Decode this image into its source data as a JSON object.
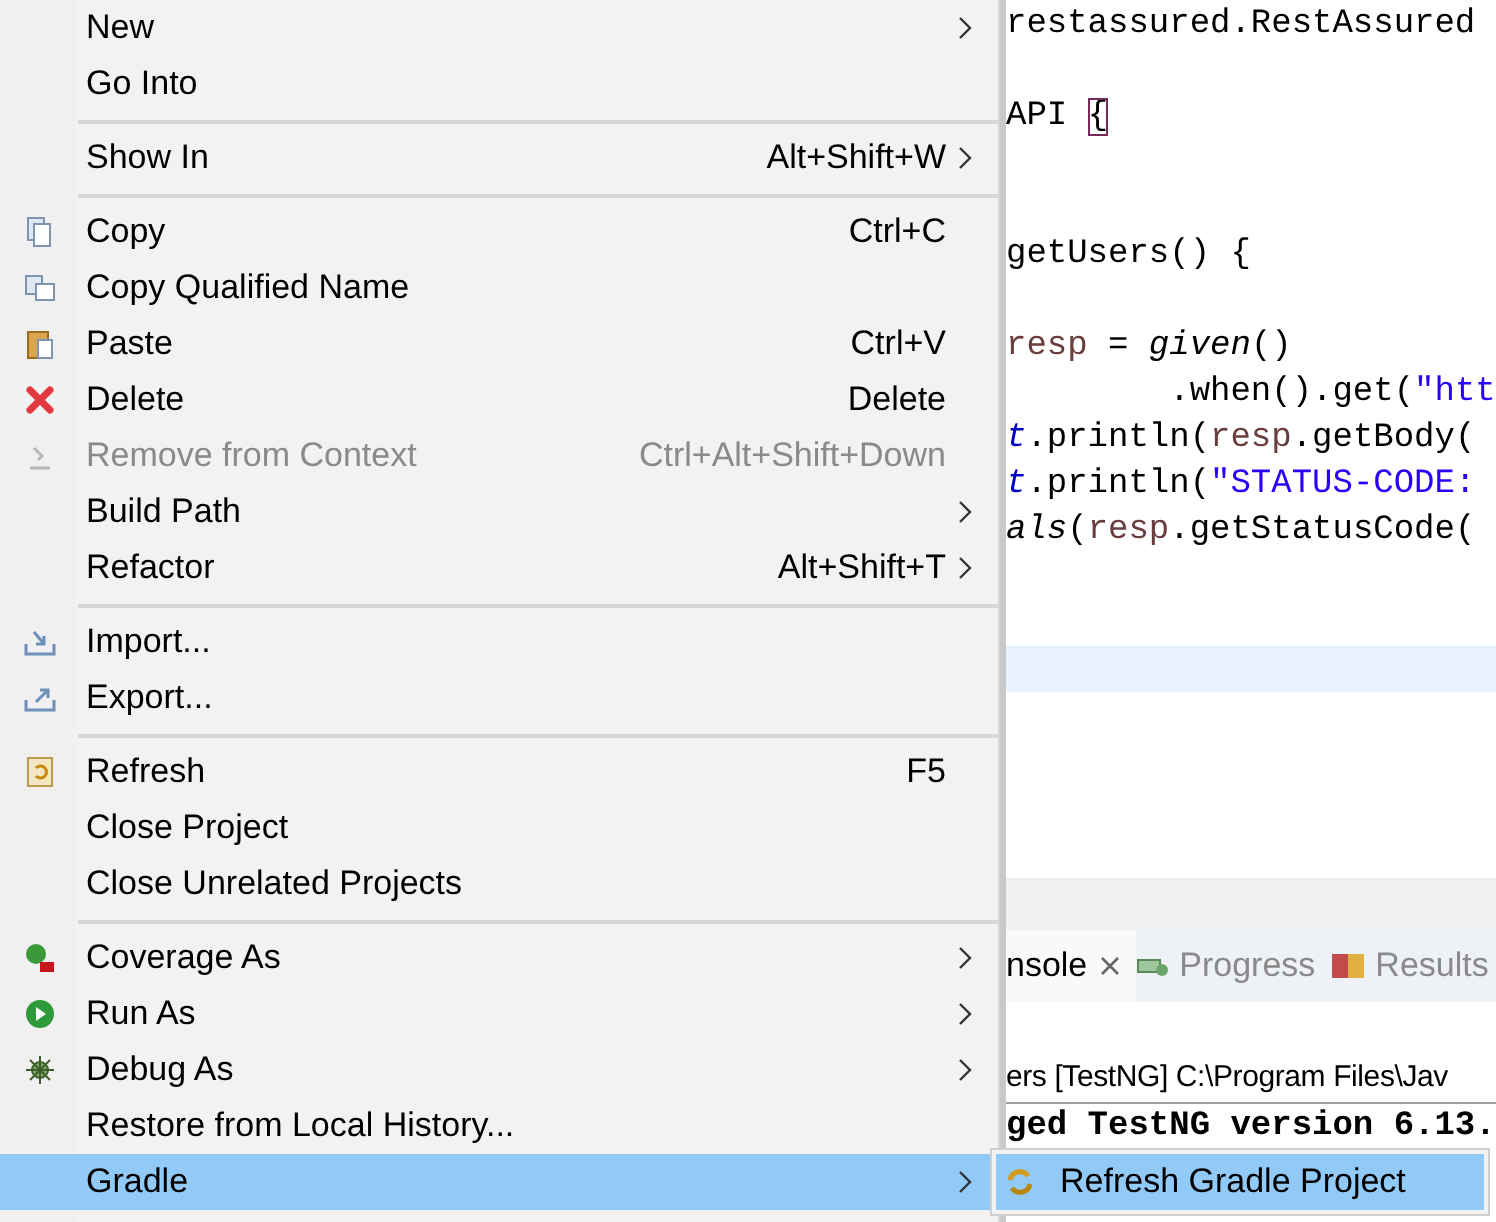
{
  "context_menu": {
    "groups": [
      [
        {
          "label": "New",
          "submenu": true,
          "disabled": false,
          "selected": false
        },
        {
          "label": "Go Into",
          "submenu": false,
          "disabled": false,
          "selected": false
        }
      ],
      [
        {
          "label": "Show In",
          "shortcut": "Alt+Shift+W",
          "submenu": true,
          "disabled": false,
          "selected": false
        }
      ],
      [
        {
          "label": "Copy",
          "shortcut": "Ctrl+C",
          "submenu": false,
          "disabled": false,
          "selected": false
        },
        {
          "label": "Copy Qualified Name",
          "submenu": false,
          "disabled": false,
          "selected": false
        },
        {
          "label": "Paste",
          "shortcut": "Ctrl+V",
          "submenu": false,
          "disabled": false,
          "selected": false
        },
        {
          "label": "Delete",
          "shortcut": "Delete",
          "submenu": false,
          "disabled": false,
          "selected": false
        },
        {
          "label": "Remove from Context",
          "shortcut": "Ctrl+Alt+Shift+Down",
          "submenu": false,
          "disabled": true,
          "selected": false
        },
        {
          "label": "Build Path",
          "submenu": true,
          "disabled": false,
          "selected": false
        },
        {
          "label": "Refactor",
          "shortcut": "Alt+Shift+T",
          "submenu": true,
          "disabled": false,
          "selected": false
        }
      ],
      [
        {
          "label": "Import...",
          "submenu": false,
          "disabled": false,
          "selected": false
        },
        {
          "label": "Export...",
          "submenu": false,
          "disabled": false,
          "selected": false
        }
      ],
      [
        {
          "label": "Refresh",
          "shortcut": "F5",
          "submenu": false,
          "disabled": false,
          "selected": false
        },
        {
          "label": "Close Project",
          "submenu": false,
          "disabled": false,
          "selected": false
        },
        {
          "label": "Close Unrelated Projects",
          "submenu": false,
          "disabled": false,
          "selected": false
        }
      ],
      [
        {
          "label": "Coverage As",
          "submenu": true,
          "disabled": false,
          "selected": false
        },
        {
          "label": "Run As",
          "submenu": true,
          "disabled": false,
          "selected": false
        },
        {
          "label": "Debug As",
          "submenu": true,
          "disabled": false,
          "selected": false
        },
        {
          "label": "Restore from Local History...",
          "submenu": false,
          "disabled": false,
          "selected": false
        },
        {
          "label": "Gradle",
          "submenu": true,
          "disabled": false,
          "selected": true
        }
      ]
    ]
  },
  "submenu": {
    "items": [
      {
        "label": "Refresh Gradle Project",
        "selected": true
      }
    ]
  },
  "editor": {
    "lines": [
      {
        "kind": "code",
        "tokens": [
          {
            "text": "restassured.RestAssured",
            "kind": "plain"
          }
        ]
      },
      {
        "kind": "blank"
      },
      {
        "kind": "code",
        "tokens": [
          {
            "text": "API ",
            "kind": "plain"
          },
          {
            "text": "{",
            "kind": "bracket"
          }
        ]
      },
      {
        "kind": "blank"
      },
      {
        "kind": "blank"
      },
      {
        "kind": "code",
        "tokens": [
          {
            "text": "getUsers() {",
            "kind": "plain"
          }
        ]
      },
      {
        "kind": "blank"
      },
      {
        "kind": "code",
        "tokens": [
          {
            "text": "resp",
            "kind": "var"
          },
          {
            "text": " = ",
            "kind": "plain"
          },
          {
            "text": "given",
            "kind": "static"
          },
          {
            "text": "()",
            "kind": "plain"
          }
        ]
      },
      {
        "kind": "code",
        "tokens": [
          {
            "text": "        .when().get(",
            "kind": "plain"
          },
          {
            "text": "\"htt",
            "kind": "string"
          }
        ]
      },
      {
        "kind": "code",
        "tokens": [
          {
            "text": "t",
            "kind": "field"
          },
          {
            "text": ".println(",
            "kind": "plain"
          },
          {
            "text": "resp",
            "kind": "var"
          },
          {
            "text": ".getBody(",
            "kind": "plain"
          }
        ]
      },
      {
        "kind": "code",
        "tokens": [
          {
            "text": "t",
            "kind": "field"
          },
          {
            "text": ".println(",
            "kind": "plain"
          },
          {
            "text": "\"STATUS-CODE:",
            "kind": "string"
          }
        ]
      },
      {
        "kind": "code",
        "tokens": [
          {
            "text": "als",
            "kind": "static"
          },
          {
            "text": "(",
            "kind": "plain"
          },
          {
            "text": "resp",
            "kind": "var"
          },
          {
            "text": ".getStatusCode(",
            "kind": "plain"
          }
        ]
      },
      {
        "kind": "blank"
      },
      {
        "kind": "blank"
      },
      {
        "kind": "current"
      }
    ]
  },
  "views": {
    "tabs": [
      {
        "label": "nsole",
        "selected": true,
        "closable": true
      },
      {
        "label": "Progress",
        "selected": false,
        "closable": false
      },
      {
        "label": "Results",
        "selected": false,
        "closable": false
      }
    ],
    "console": {
      "header": "ers [TestNG] C:\\Program Files\\Jav",
      "lines": [
        "ged TestNG version 6.13."
      ]
    }
  }
}
